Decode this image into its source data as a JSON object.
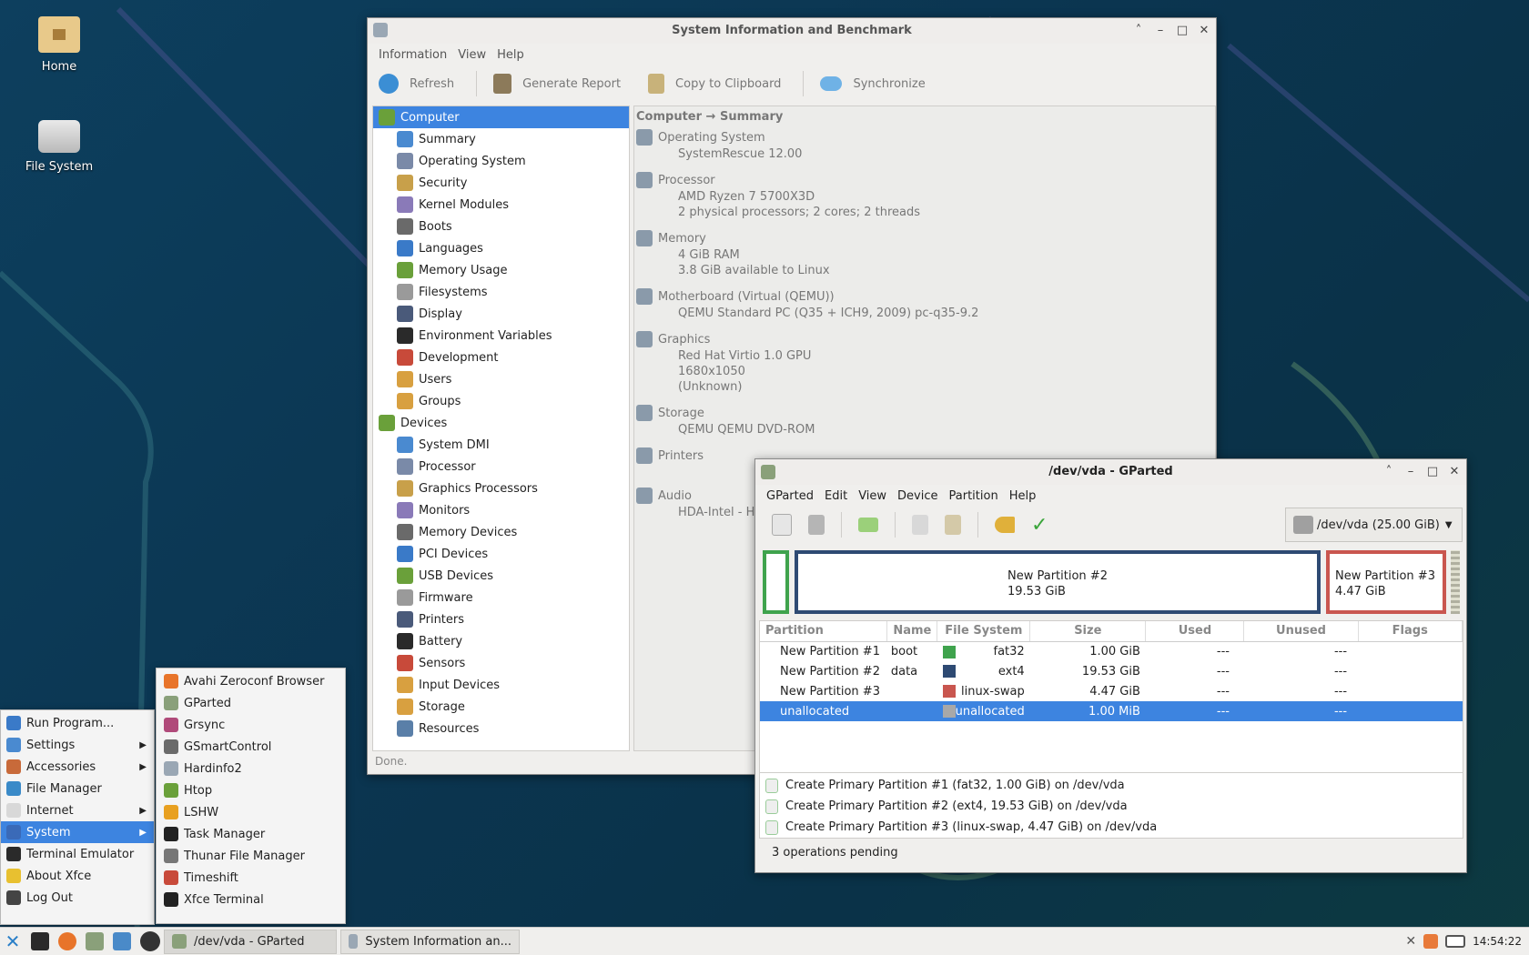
{
  "desktop": {
    "icons": [
      {
        "label": "Home"
      },
      {
        "label": "File System"
      }
    ]
  },
  "hardinfo": {
    "title": "System Information and Benchmark",
    "menu": [
      "Information",
      "View",
      "Help"
    ],
    "toolbar": {
      "refresh": "Refresh",
      "report": "Generate Report",
      "copy": "Copy to Clipboard",
      "sync": "Synchronize"
    },
    "tree": [
      {
        "label": "Computer",
        "indent": 0,
        "selected": true
      },
      {
        "label": "Summary",
        "indent": 1
      },
      {
        "label": "Operating System",
        "indent": 1
      },
      {
        "label": "Security",
        "indent": 1
      },
      {
        "label": "Kernel Modules",
        "indent": 1
      },
      {
        "label": "Boots",
        "indent": 1
      },
      {
        "label": "Languages",
        "indent": 1
      },
      {
        "label": "Memory Usage",
        "indent": 1
      },
      {
        "label": "Filesystems",
        "indent": 1
      },
      {
        "label": "Display",
        "indent": 1
      },
      {
        "label": "Environment Variables",
        "indent": 1
      },
      {
        "label": "Development",
        "indent": 1
      },
      {
        "label": "Users",
        "indent": 1
      },
      {
        "label": "Groups",
        "indent": 1
      },
      {
        "label": "Devices",
        "indent": 0
      },
      {
        "label": "System DMI",
        "indent": 1
      },
      {
        "label": "Processor",
        "indent": 1
      },
      {
        "label": "Graphics Processors",
        "indent": 1
      },
      {
        "label": "Monitors",
        "indent": 1
      },
      {
        "label": "Memory Devices",
        "indent": 1
      },
      {
        "label": "PCI Devices",
        "indent": 1
      },
      {
        "label": "USB Devices",
        "indent": 1
      },
      {
        "label": "Firmware",
        "indent": 1
      },
      {
        "label": "Printers",
        "indent": 1
      },
      {
        "label": "Battery",
        "indent": 1
      },
      {
        "label": "Sensors",
        "indent": 1
      },
      {
        "label": "Input Devices",
        "indent": 1
      },
      {
        "label": "Storage",
        "indent": 1
      },
      {
        "label": "Resources",
        "indent": 1
      }
    ],
    "breadcrumb": "Computer → Summary",
    "summary": [
      {
        "head": "Operating System",
        "values": [
          "SystemRescue 12.00"
        ]
      },
      {
        "head": "Processor",
        "values": [
          "AMD Ryzen 7 5700X3D",
          "2 physical processors; 2 cores; 2 threads"
        ]
      },
      {
        "head": "Memory",
        "values": [
          "4 GiB RAM",
          "3.8 GiB available to Linux"
        ]
      },
      {
        "head": "Motherboard (Virtual (QEMU))",
        "values": [
          "QEMU Standard PC (Q35 + ICH9, 2009) pc-q35-9.2"
        ]
      },
      {
        "head": "Graphics",
        "values": [
          "Red Hat Virtio 1.0 GPU",
          "1680x1050",
          "(Unknown)"
        ]
      },
      {
        "head": "Storage",
        "values": [
          "QEMU QEMU DVD-ROM"
        ]
      },
      {
        "head": "Printers",
        "values": []
      },
      {
        "head": "Audio",
        "values": [
          "HDA-Intel - H"
        ]
      }
    ],
    "status": "Done."
  },
  "gparted": {
    "title": "/dev/vda - GParted",
    "menu": [
      "GParted",
      "Edit",
      "View",
      "Device",
      "Partition",
      "Help"
    ],
    "device": "/dev/vda (25.00 GiB)",
    "map": [
      {
        "name": "New Partition #2",
        "size": "19.53 GiB"
      },
      {
        "name": "New Partition #3",
        "size": "4.47 GiB"
      }
    ],
    "columns": [
      "Partition",
      "Name",
      "File System",
      "Size",
      "Used",
      "Unused",
      "Flags"
    ],
    "rows": [
      {
        "partition": "New Partition #1",
        "name": "boot",
        "fs": "fat32",
        "color": "#3fa34d",
        "size": "1.00 GiB",
        "used": "---",
        "unused": "---",
        "flags": ""
      },
      {
        "partition": "New Partition #2",
        "name": "data",
        "fs": "ext4",
        "color": "#2e4a73",
        "size": "19.53 GiB",
        "used": "---",
        "unused": "---",
        "flags": ""
      },
      {
        "partition": "New Partition #3",
        "name": "",
        "fs": "linux-swap",
        "color": "#c9564f",
        "size": "4.47 GiB",
        "used": "---",
        "unused": "---",
        "flags": ""
      },
      {
        "partition": "unallocated",
        "name": "",
        "fs": "unallocated",
        "color": "#a8a8a8",
        "size": "1.00 MiB",
        "used": "---",
        "unused": "---",
        "flags": "",
        "selected": true
      }
    ],
    "operations": [
      "Create Primary Partition #1 (fat32, 1.00 GiB) on /dev/vda",
      "Create Primary Partition #2 (ext4, 19.53 GiB) on /dev/vda",
      "Create Primary Partition #3 (linux-swap, 4.47 GiB) on /dev/vda"
    ],
    "status": "3 operations pending"
  },
  "appmenu": {
    "items": [
      {
        "label": "Run Program...",
        "sub": false
      },
      {
        "label": "Settings",
        "sub": true
      },
      {
        "label": "Accessories",
        "sub": true
      },
      {
        "label": "File Manager",
        "sub": false
      },
      {
        "label": "Internet",
        "sub": true
      },
      {
        "label": "System",
        "sub": true,
        "selected": true
      },
      {
        "label": "Terminal Emulator",
        "sub": false
      },
      {
        "label": "About Xfce",
        "sub": false
      },
      {
        "label": "Log Out",
        "sub": false
      }
    ],
    "submenu": [
      "Avahi Zeroconf Browser",
      "GParted",
      "Grsync",
      "GSmartControl",
      "Hardinfo2",
      "Htop",
      "LSHW",
      "Task Manager",
      "Thunar File Manager",
      "Timeshift",
      "Xfce Terminal"
    ]
  },
  "taskbar": {
    "tasks": [
      "/dev/vda - GParted",
      "System Information an..."
    ],
    "clock": "14:54:22"
  }
}
